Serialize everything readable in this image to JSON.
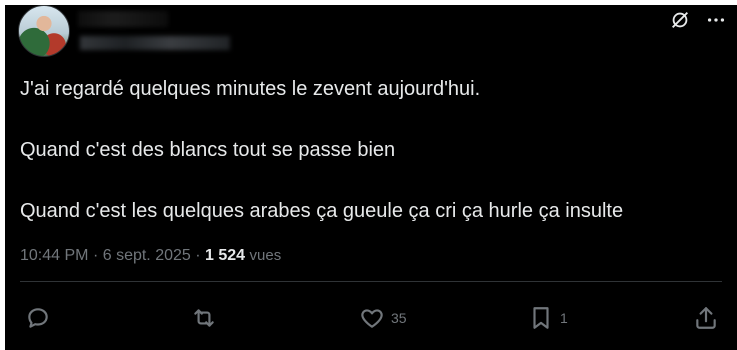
{
  "tweet": {
    "lines": [
      "J'ai regardé quelques minutes le zevent aujourd'hui.",
      "Quand c'est des blancs tout se passe bien",
      "Quand c'est les quelques arabes ça gueule ça cri ça hurle ça insulte"
    ],
    "time": "10:44 PM",
    "separator": "·",
    "date": "6 sept. 2025",
    "views_count": "1 524",
    "views_label": "vues"
  },
  "actions": {
    "reply_icon": "reply-icon",
    "retweet_icon": "retweet-icon",
    "like_icon": "heart-icon",
    "like_count": "35",
    "bookmark_icon": "bookmark-icon",
    "bookmark_count": "1",
    "share_icon": "share-icon"
  },
  "colors": {
    "background": "#000000",
    "text": "#e7e9ea",
    "muted": "#71767b",
    "divider": "#2f3336"
  }
}
